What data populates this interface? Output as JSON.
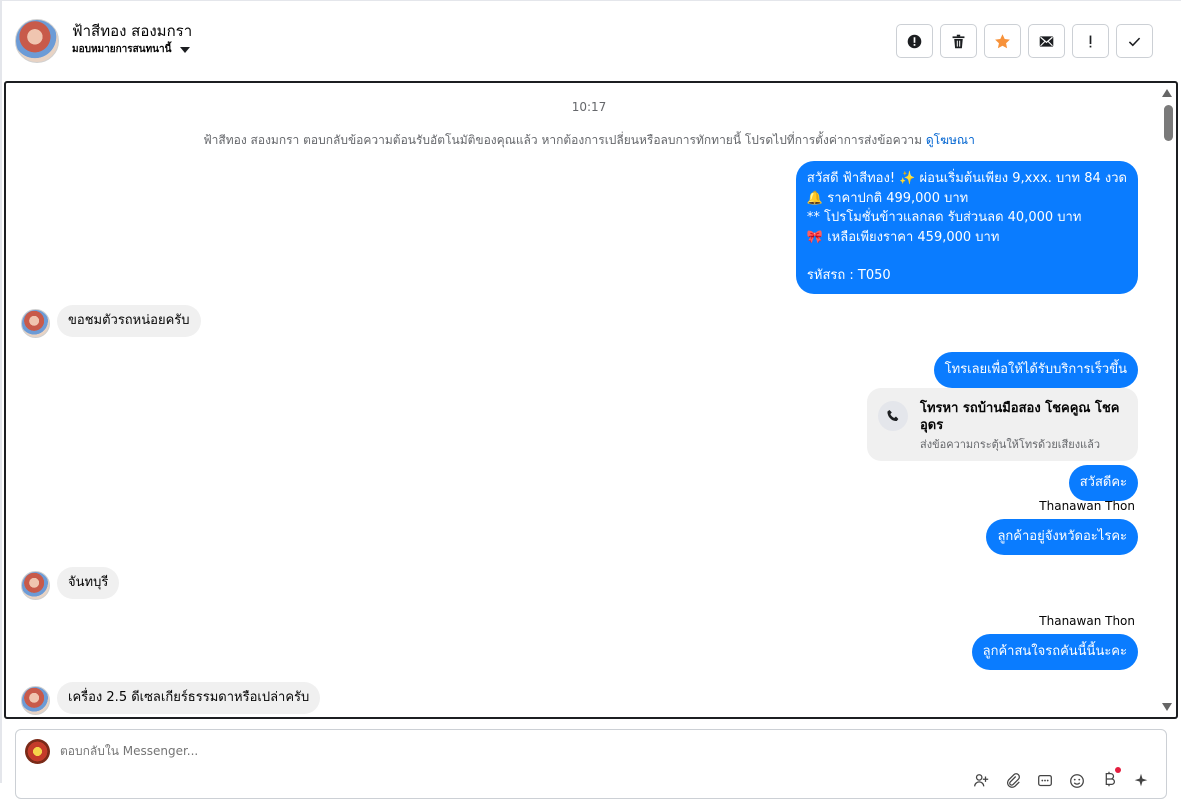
{
  "header": {
    "name": "ฟ้าสีทอง สองมกรา",
    "assign_label": "มอบหมายการสนทนานี้"
  },
  "toolbar": [
    {
      "name": "report-button",
      "icon": "alert-circle-icon"
    },
    {
      "name": "delete-button",
      "icon": "trash-icon"
    },
    {
      "name": "star-button",
      "icon": "star-icon",
      "color": "#f7923a"
    },
    {
      "name": "mail-button",
      "icon": "envelope-icon"
    },
    {
      "name": "important-button",
      "icon": "exclamation-icon"
    },
    {
      "name": "done-button",
      "icon": "check-icon"
    }
  ],
  "chat": {
    "timestamp": "10:17",
    "system_note": "ฟ้าสีทอง สองมกรา ตอบกลับข้อความต้อนรับอัตโนมัติของคุณแล้ว หากต้องการเปลี่ยนหรือลบการทักทายนี้ โปรดไปที่การตั้งค่าการส่งข้อความ",
    "system_note_link": "ดูโฆษณา",
    "messages": {
      "promo_line1": "สวัสดี ฟ้าสีทอง! ✨  ผ่อนเริ่มต้นเพียง 9,xxx. บาท 84 งวด",
      "promo_line2": "🔔 ราคาปกติ 499,000 บาท",
      "promo_line3": "** โปรโมชั่นข้าวแลกลด รับส่วนลด 40,000 บาท",
      "promo_line4": "🎀  เหลือเพียงราคา 459,000 บาท",
      "promo_line5": "รหัสรถ : T050",
      "in1": "ขอชมตัวรถหน่อยครับ",
      "out2": "โทรเลยเพื่อให้ได้รับบริการเร็วขึ้น",
      "call_title": "โทรหา รถบ้านมือสอง โชคคูณ โชคอุดร",
      "call_sub": "ส่งข้อความกระตุ้นให้โทรด้วยเสียงแล้ว",
      "out3": "สวัสดีคะ",
      "sender1": "Thanawan Thon",
      "out4": "ลูกค้าอยู่จังหวัดอะไรคะ",
      "in2": "จันทบุรี",
      "sender2": "Thanawan Thon",
      "out5": "ลูกค้าสนใจรถคันนี้นี้นะคะ",
      "in3": "เครื่อง 2.5 ดีเซลเกียร์ธรรมดาหรือเปล่าครับ"
    }
  },
  "composer": {
    "placeholder": "ตอบกลับใน Messenger..."
  },
  "colors": {
    "outgoing": "#0a7cff",
    "incoming": "#f0f0f0",
    "link": "#0064d1"
  }
}
